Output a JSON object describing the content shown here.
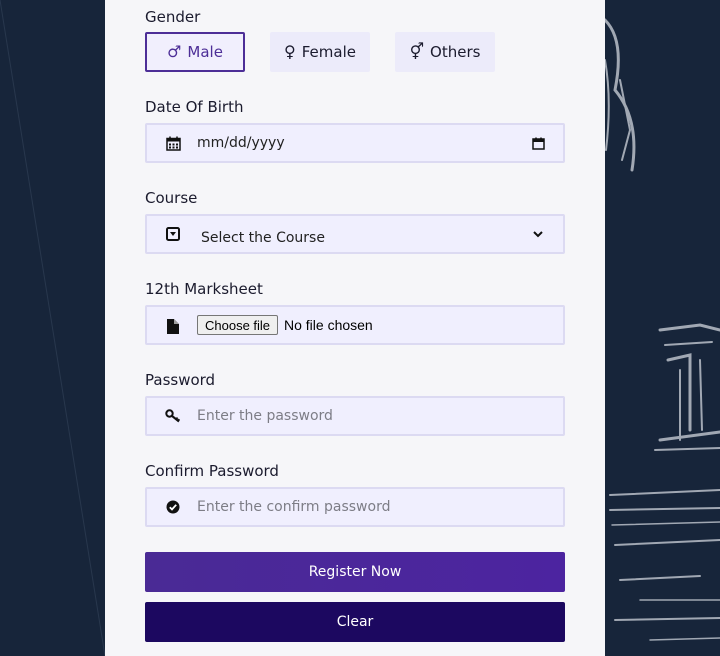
{
  "gender": {
    "label": "Gender",
    "options": [
      {
        "label": "Male",
        "icon": "male-icon",
        "selected": true
      },
      {
        "label": "Female",
        "icon": "female-icon",
        "selected": false
      },
      {
        "label": "Others",
        "icon": "transgender-icon",
        "selected": false
      }
    ]
  },
  "dob": {
    "label": "Date Of Birth",
    "value": "mm/dd/yyyy",
    "icon": "calendar-icon"
  },
  "course": {
    "label": "Course",
    "value": "Select the Course",
    "icon": "caret-square-down-icon"
  },
  "marksheet": {
    "label": "12th Marksheet",
    "button": "Choose file",
    "status": "No file chosen",
    "icon": "file-icon"
  },
  "password": {
    "label": "Password",
    "placeholder": "Enter the password",
    "icon": "key-icon"
  },
  "confirm": {
    "label": "Confirm Password",
    "placeholder": "Enter the confirm password",
    "icon": "check-circle-icon"
  },
  "actions": {
    "register": "Register Now",
    "clear": "Clear"
  },
  "colors": {
    "accent": "#4d2e97",
    "register_bg": "#4a2a95",
    "clear_bg": "#1c0860",
    "field_bg": "#f0effe",
    "page_bg": "#17253a"
  }
}
